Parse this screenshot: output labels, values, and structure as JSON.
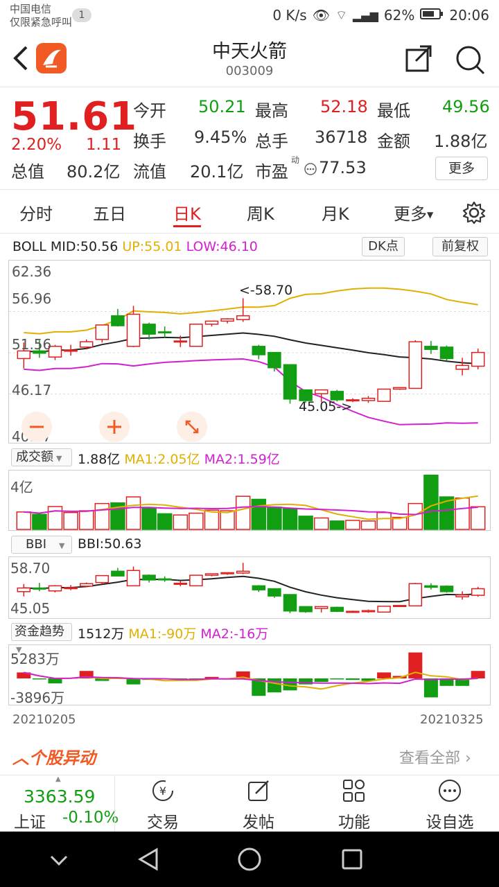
{
  "status": {
    "carrier1": "中国电信",
    "carrier2": "仅限紧急呼叫",
    "badge": "1",
    "speed": "0 K/s",
    "battery": "62%",
    "time": "20:06"
  },
  "header": {
    "title": "中天火箭",
    "code": "003009"
  },
  "quote": {
    "price": "51.61",
    "pct": "2.20%",
    "change": "1.11",
    "open_label": "今开",
    "open": "50.21",
    "high_label": "最高",
    "high": "52.18",
    "low_label": "最低",
    "low": "49.56",
    "turnover_label": "换手",
    "turnover": "9.45%",
    "vol_label": "总手",
    "vol": "36718",
    "amount_label": "金额",
    "amount": "1.88亿",
    "mktcap_label": "总值",
    "mktcap": "80.2亿",
    "float_label": "流值",
    "float": "20.1亿",
    "pe_label": "市盈",
    "pe_sup": "动",
    "pe": "77.53",
    "more": "更多"
  },
  "tabs": [
    "分时",
    "五日",
    "日K",
    "周K",
    "月K",
    "更多"
  ],
  "boll": {
    "mid": "BOLL MID:50.56",
    "up": "UP:55.01",
    "low": "LOW:46.10",
    "dk": "DK点",
    "adj": "前复权"
  },
  "main_axis": [
    "62.36",
    "56.96",
    "51.56",
    "46.17",
    "40.77"
  ],
  "annotations": {
    "high": "<-58.70",
    "low": "45.05->"
  },
  "volume": {
    "selector": "成交额",
    "value": "1.88亿",
    "ma1": "MA1:2.05亿",
    "ma2": "MA2:1.59亿",
    "axis": "4亿"
  },
  "bbi": {
    "selector": "BBI",
    "value": "BBI:50.63",
    "axis_top": "58.70",
    "axis_bottom": "45.05"
  },
  "fund": {
    "selector": "资金趋势",
    "value": "1512万",
    "ma1": "MA1:-90万",
    "ma2": "MA2:-16万",
    "axis_top": "5283万",
    "axis_bottom": "-3896万"
  },
  "dates": {
    "start": "20210205",
    "end": "20210325"
  },
  "section": {
    "title": "个股异动",
    "link": "查看全部"
  },
  "bottom": {
    "index_value": "3363.59",
    "index_name": "上证",
    "index_change": "-0.10%",
    "trade": "交易",
    "post": "发帖",
    "func": "功能",
    "watch": "设自选"
  },
  "colors": {
    "up": "#e02020",
    "down": "#129e12",
    "accent": "#f15a24",
    "boll_up": "#e0b000",
    "boll_low": "#d020d0",
    "mid": "#222222"
  },
  "chart_data": {
    "type": "candlestick",
    "title": "BOLL",
    "x": [
      "20210205",
      "20210325"
    ],
    "ylim": [
      40.77,
      62.36
    ],
    "ohlc": [
      [
        50.8,
        51.8,
        49.5,
        52.9
      ],
      [
        51.8,
        51.5,
        50.9,
        53.2
      ],
      [
        51.0,
        52.4,
        50.6,
        52.6
      ],
      [
        51.8,
        51.9,
        51.2,
        52.6
      ],
      [
        52.3,
        53.0,
        52.0,
        53.3
      ],
      [
        53.3,
        55.2,
        52.9,
        55.2
      ],
      [
        56.4,
        55.1,
        55.0,
        57.3
      ],
      [
        52.4,
        56.6,
        52.3,
        57.7
      ],
      [
        55.3,
        54.0,
        53.3,
        55.5
      ],
      [
        54.3,
        54.2,
        53.5,
        55.0
      ],
      [
        53.0,
        53.1,
        52.3,
        53.8
      ],
      [
        52.4,
        55.3,
        52.4,
        55.3
      ],
      [
        55.3,
        55.7,
        55.0,
        55.7
      ],
      [
        55.7,
        56.0,
        55.4,
        56.1
      ],
      [
        55.9,
        56.4,
        55.6,
        58.7
      ],
      [
        52.4,
        51.3,
        50.7,
        52.6
      ],
      [
        51.6,
        49.6,
        49.1,
        51.6
      ],
      [
        50.0,
        45.5,
        44.9,
        50.0
      ],
      [
        46.7,
        45.3,
        45.0,
        46.7
      ],
      [
        46.2,
        46.7,
        45.1,
        46.7
      ],
      [
        46.5,
        45.4,
        45.2,
        46.7
      ],
      [
        45.3,
        45.4,
        45.1,
        45.6
      ],
      [
        45.3,
        45.6,
        45.0,
        45.9
      ],
      [
        45.2,
        46.8,
        45.2,
        46.8
      ],
      [
        46.8,
        47.0,
        46.7,
        47.0
      ],
      [
        46.9,
        53.0,
        46.9,
        53.2
      ],
      [
        52.4,
        52.0,
        51.4,
        53.1
      ],
      [
        52.3,
        50.8,
        50.5,
        52.5
      ],
      [
        49.4,
        49.9,
        48.6,
        50.9
      ],
      [
        49.8,
        51.6,
        49.4,
        52.1
      ]
    ],
    "volume": [
      1.45,
      1.25,
      1.9,
      1.4,
      1.55,
      2.15,
      2.2,
      2.7,
      1.8,
      1.3,
      1.2,
      1.35,
      1.6,
      1.55,
      2.75,
      2.5,
      1.85,
      1.75,
      1.1,
      0.95,
      0.7,
      0.75,
      0.7,
      1.4,
      1.0,
      2.15,
      4.5,
      2.7,
      2.6,
      1.88
    ],
    "fund": [
      12,
      -2,
      -10,
      1,
      15,
      -5,
      -1,
      -12,
      -3,
      -2,
      -2,
      -1,
      3,
      -2,
      14,
      -35,
      -28,
      -24,
      -12,
      -7,
      -2,
      -3,
      -5,
      12,
      5,
      52,
      -38,
      -15,
      -15,
      15
    ]
  }
}
